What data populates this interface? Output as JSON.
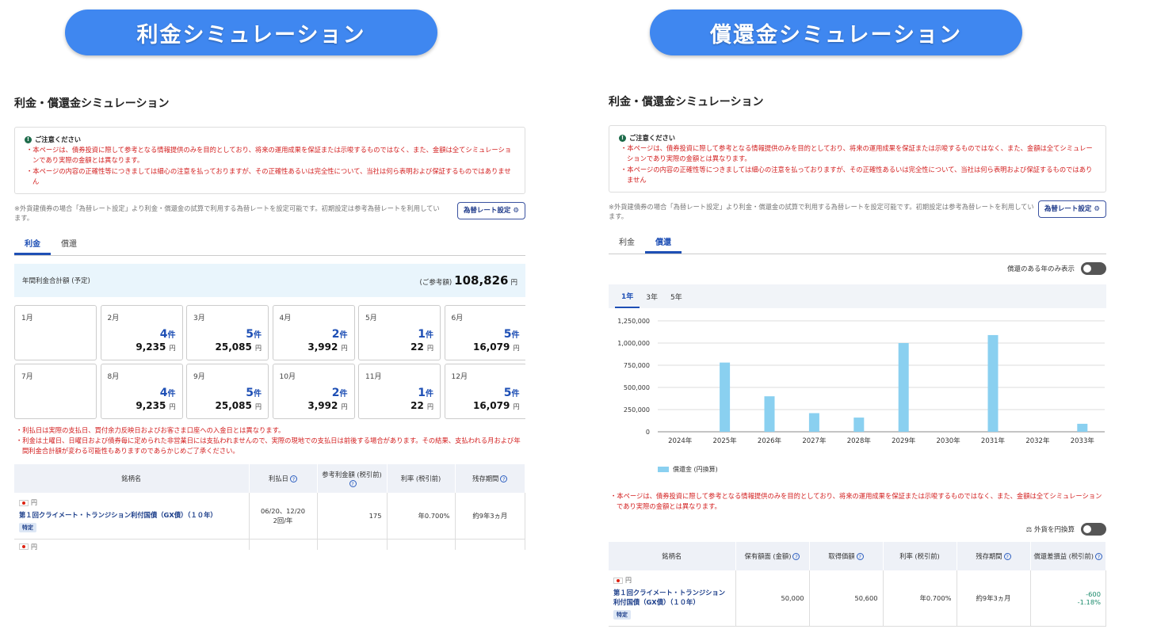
{
  "banner_left": "利金シミュレーション",
  "banner_right": "償還金シミュレーション",
  "page_title": "利金・償還金シミュレーション",
  "notice": {
    "heading": "ご注意ください",
    "items": [
      "・本ページは、債券投資に際して参考となる情報提供のみを目的としており、将来の運用成果を保証または示唆するものではなく、また、金額は全てシミュレーションであり実際の金額とは異なります。",
      "・本ページの内容の正確性等につきましては細心の注意を払っておりますが、その正確性あるいは完全性について、当社は何ら表明および保証するものではありません"
    ]
  },
  "rate_text": "※外貨建債券の場合「為替レート設定」より利金・償還金の試算で利用する為替レートを設定可能です。初期設定は参考為替レートを利用しています。",
  "rate_button": "為替レート設定 ⚙",
  "tabs": {
    "interest": "利金",
    "redemption": "償還"
  },
  "left": {
    "annual_label": "年間利金合計額 (予定)",
    "annual_prefix": "(ご参考額)",
    "annual_value": "108,826",
    "annual_unit": "円",
    "months": [
      {
        "m": "1月",
        "count": "",
        "unit": "",
        "yen": "",
        "yu": ""
      },
      {
        "m": "2月",
        "count": "4",
        "unit": "件",
        "yen": "9,235",
        "yu": "円"
      },
      {
        "m": "3月",
        "count": "5",
        "unit": "件",
        "yen": "25,085",
        "yu": "円"
      },
      {
        "m": "4月",
        "count": "2",
        "unit": "件",
        "yen": "3,992",
        "yu": "円"
      },
      {
        "m": "5月",
        "count": "1",
        "unit": "件",
        "yen": "22",
        "yu": "円"
      },
      {
        "m": "6月",
        "count": "5",
        "unit": "件",
        "yen": "16,079",
        "yu": "円"
      },
      {
        "m": "7月",
        "count": "",
        "unit": "",
        "yen": "",
        "yu": ""
      },
      {
        "m": "8月",
        "count": "4",
        "unit": "件",
        "yen": "9,235",
        "yu": "円"
      },
      {
        "m": "9月",
        "count": "5",
        "unit": "件",
        "yen": "25,085",
        "yu": "円"
      },
      {
        "m": "10月",
        "count": "2",
        "unit": "件",
        "yen": "3,992",
        "yu": "円"
      },
      {
        "m": "11月",
        "count": "1",
        "unit": "件",
        "yen": "22",
        "yu": "円"
      },
      {
        "m": "12月",
        "count": "5",
        "unit": "件",
        "yen": "16,079",
        "yu": "円"
      }
    ],
    "warnings": [
      "・利払日は実際の支払日、買付余力反映日およびお客さま口座への入金日とは異なります。",
      "・利金は土曜日、日曜日および債券毎に定められた非営業日には支払われませんので、実際の現地での支払日は前後する場合があります。その結果、支払われる月および年間利金合計額が変わる可能性もありますのであらかじめご了承ください。"
    ],
    "table_headers": [
      "銘柄名",
      "利払日",
      "参考利金額 (税引前)",
      "利率 (税引前)",
      "残存期間"
    ],
    "row": {
      "currency": "円",
      "name": "第１回クライメート・トランジション利付国債（GX債）（１０年）",
      "tag": "特定",
      "payday": "06/20、12/20",
      "freq": "2回/年",
      "amount": "175",
      "rate": "年0.700%",
      "term": "約9年3ヵ月"
    },
    "row2_currency": "円"
  },
  "right": {
    "toggle_label": "償還のある年のみ表示",
    "period_tabs": [
      "1年",
      "3年",
      "5年"
    ],
    "legend": "償還金 (円換算)",
    "warning": "・本ページは、債券投資に際して参考となる情報提供のみを目的としており、将来の運用成果を保証または示唆するものではなく、また、金額は全てシミュレーションであり実際の金額とは異なります。",
    "fx_toggle": "外貨を円換算",
    "table_headers": [
      "銘柄名",
      "保有額面 (金額)",
      "取得価額",
      "利率 (税引前)",
      "残存期間",
      "償還差損益 (税引前)"
    ],
    "row": {
      "currency": "円",
      "name": "第１回クライメート・トランジション利付国債（GX債）（１０年）",
      "tag": "特定",
      "face": "50,000",
      "cost": "50,600",
      "rate": "年0.700%",
      "term": "約9年3ヵ月",
      "pl": "-600",
      "pl_pct": "-1.18%"
    }
  },
  "chart_data": {
    "type": "bar",
    "categories": [
      "2024年",
      "2025年",
      "2026年",
      "2027年",
      "2028年",
      "2029年",
      "2030年",
      "2031年",
      "2032年",
      "2033年"
    ],
    "series": [
      {
        "name": "償還金 (円換算)",
        "values": [
          0,
          780000,
          400000,
          210000,
          160000,
          1000000,
          0,
          1090000,
          0,
          90000
        ]
      }
    ],
    "ylim": [
      0,
      1250000
    ],
    "yticks": [
      0,
      250000,
      500000,
      750000,
      1000000,
      1250000
    ],
    "ytick_labels": [
      "0",
      "250,000",
      "500,000",
      "750,000",
      "1,000,000",
      "1,250,000"
    ],
    "bar_color": "#8ad0f0",
    "grid": true
  }
}
